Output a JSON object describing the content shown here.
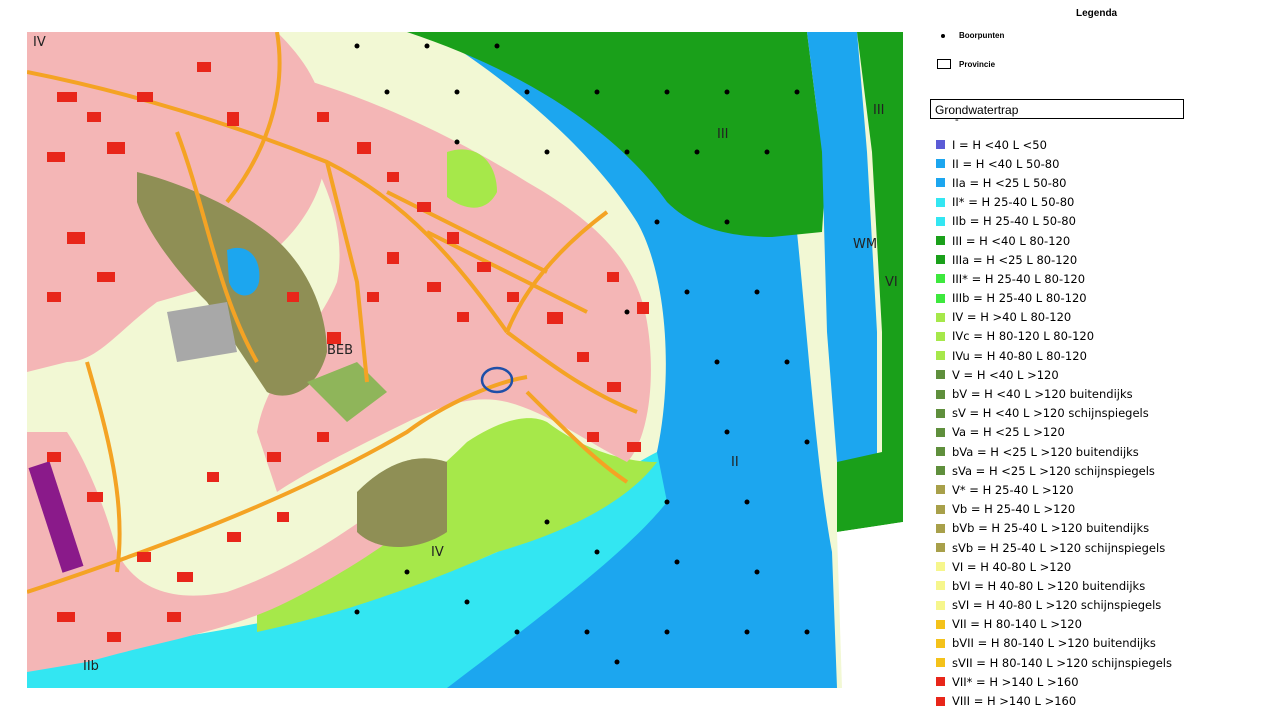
{
  "legend": {
    "title": "Legenda",
    "items": [
      {
        "label": "Boorpunten",
        "symbol": "dot-icon"
      },
      {
        "label": "Provincie",
        "symbol": "outline-box-icon"
      }
    ]
  },
  "grondwatertrap": {
    "title": "Grondwatertrap",
    "dash": "-",
    "classes": [
      {
        "label": "I =  H <40  L <50",
        "color": "#5b5bd6"
      },
      {
        "label": "II =  H <40  L 50-80",
        "color": "#1ca6ef"
      },
      {
        "label": "IIa =  H <25  L 50-80",
        "color": "#1ca6ef"
      },
      {
        "label": "II* =  H 25-40  L 50-80",
        "color": "#33e6f2"
      },
      {
        "label": "IIb =  H 25-40  L 50-80",
        "color": "#33e6f2"
      },
      {
        "label": "III =  H <40  L 80-120",
        "color": "#1aa01a"
      },
      {
        "label": "IIIa =  H <25  L 80-120",
        "color": "#1aa01a"
      },
      {
        "label": "III* =  H 25-40  L 80-120",
        "color": "#3de83d"
      },
      {
        "label": "IIIb =  H 25-40  L 80-120",
        "color": "#3de83d"
      },
      {
        "label": "IV =   H >40  L 80-120",
        "color": "#a6e84a"
      },
      {
        "label": "IVc =  H 80-120  L 80-120",
        "color": "#a6e84a"
      },
      {
        "label": "IVu =  H 40-80  L 80-120",
        "color": "#a6e84a"
      },
      {
        "label": "V =  H <40  L >120",
        "color": "#5f8f3c"
      },
      {
        "label": "bV =  H <40  L >120  buitendijks",
        "color": "#5f8f3c"
      },
      {
        "label": "sV =  H <40  L >120  schijnspiegels",
        "color": "#5f8f3c"
      },
      {
        "label": "Va =  H <25  L >120",
        "color": "#5f8f3c"
      },
      {
        "label": "bVa =  H <25  L >120  buitendijks",
        "color": "#5f8f3c"
      },
      {
        "label": "sVa =  H <25  L >120  schijnspiegels",
        "color": "#5f8f3c"
      },
      {
        "label": "V* =  H 25-40  L >120",
        "color": "#a8a04a"
      },
      {
        "label": "Vb =  H 25-40  L >120",
        "color": "#a8a04a"
      },
      {
        "label": "bVb =  H 25-40  L >120  buitendijks",
        "color": "#a8a04a"
      },
      {
        "label": "sVb =  H 25-40  L >120  schijnspiegels",
        "color": "#a8a04a"
      },
      {
        "label": "VI =  H 40-80  L >120",
        "color": "#f6f68c"
      },
      {
        "label": "bVI =  H 40-80  L >120  buitendijks",
        "color": "#f6f68c"
      },
      {
        "label": "sVI =  H 40-80  L >120  schijnspiegels",
        "color": "#f6f68c"
      },
      {
        "label": "VII =  H 80-140  L >120",
        "color": "#f4c21a"
      },
      {
        "label": "bVII =  H 80-140  L >120  buitendijks",
        "color": "#f4c21a"
      },
      {
        "label": "sVII =  H 80-140  L >120  schijnspiegels",
        "color": "#f4c21a"
      },
      {
        "label": "VII* =  H >140  L >160",
        "color": "#e8261a"
      },
      {
        "label": "VIII =  H >140  L >160",
        "color": "#e8261a"
      }
    ]
  },
  "map": {
    "zone_labels": {
      "iv_topleft": "IV",
      "iii_river_east": "III",
      "iii_far_east": "III",
      "wm": "WM",
      "vi": "VI",
      "beb": "BEB",
      "ii_river": "II",
      "iv_south": "IV",
      "iib": "IIb"
    },
    "colors": {
      "urban": "#f4b6b6",
      "buildings": "#e8261a",
      "roads": "#f4a324",
      "river": "#1ca6ef",
      "zone_iii": "#1aa01a",
      "zone_iv": "#a6e84a",
      "zone_v": "#8f8f55",
      "zone_vi": "#f2f8d4",
      "zone_iib": "#33e6f2"
    }
  }
}
